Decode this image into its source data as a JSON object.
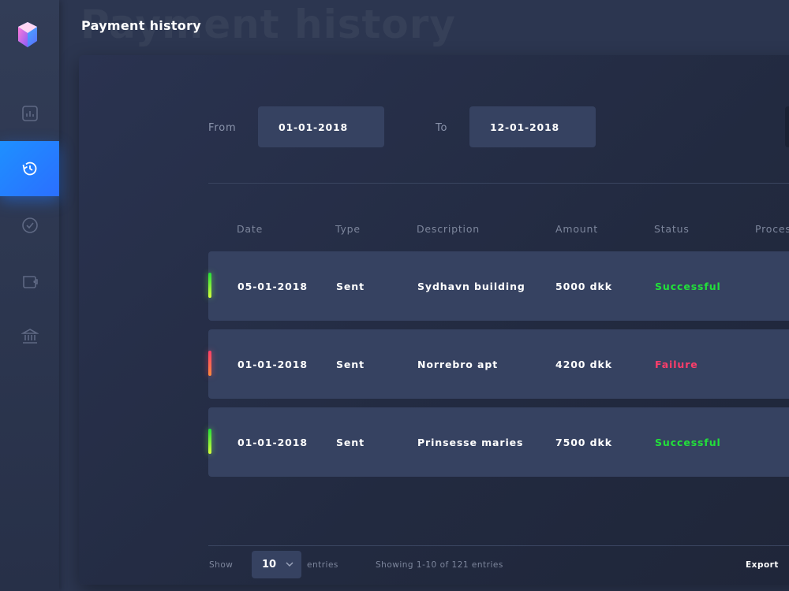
{
  "page": {
    "title": "Payment history",
    "title_ghost": "Payment history"
  },
  "sidebar": {
    "items": [
      {
        "icon": "chart-icon",
        "active": false
      },
      {
        "icon": "history-icon",
        "active": true
      },
      {
        "icon": "check-circle-icon",
        "active": false
      },
      {
        "icon": "wallet-icon",
        "active": false
      },
      {
        "icon": "bank-icon",
        "active": false
      }
    ]
  },
  "filter": {
    "from_label": "From",
    "from_value": "01-01-2018",
    "to_label": "To",
    "to_value": "12-01-2018"
  },
  "table": {
    "columns": [
      "Date",
      "Type",
      "Description",
      "Amount",
      "Status",
      "Proces"
    ],
    "rows": [
      {
        "date": "05-01-2018",
        "type": "Sent",
        "description": "Sydhavn building",
        "amount": "5000 dkk",
        "status": "Successful"
      },
      {
        "date": "01-01-2018",
        "type": "Sent",
        "description": "Norrebro apt",
        "amount": "4200 dkk",
        "status": "Failure"
      },
      {
        "date": "01-01-2018",
        "type": "Sent",
        "description": "Prinsesse maries",
        "amount": "7500 dkk",
        "status": "Successful"
      }
    ]
  },
  "footer": {
    "show_label": "Show",
    "entries_value": "10",
    "entries_label": "entries",
    "showing_text": "Showing 1-10 of 121 entries",
    "export_label": "Export"
  },
  "colors": {
    "success": "#22e03a",
    "failure": "#ff3d6a",
    "accent": "#1e90ff"
  }
}
